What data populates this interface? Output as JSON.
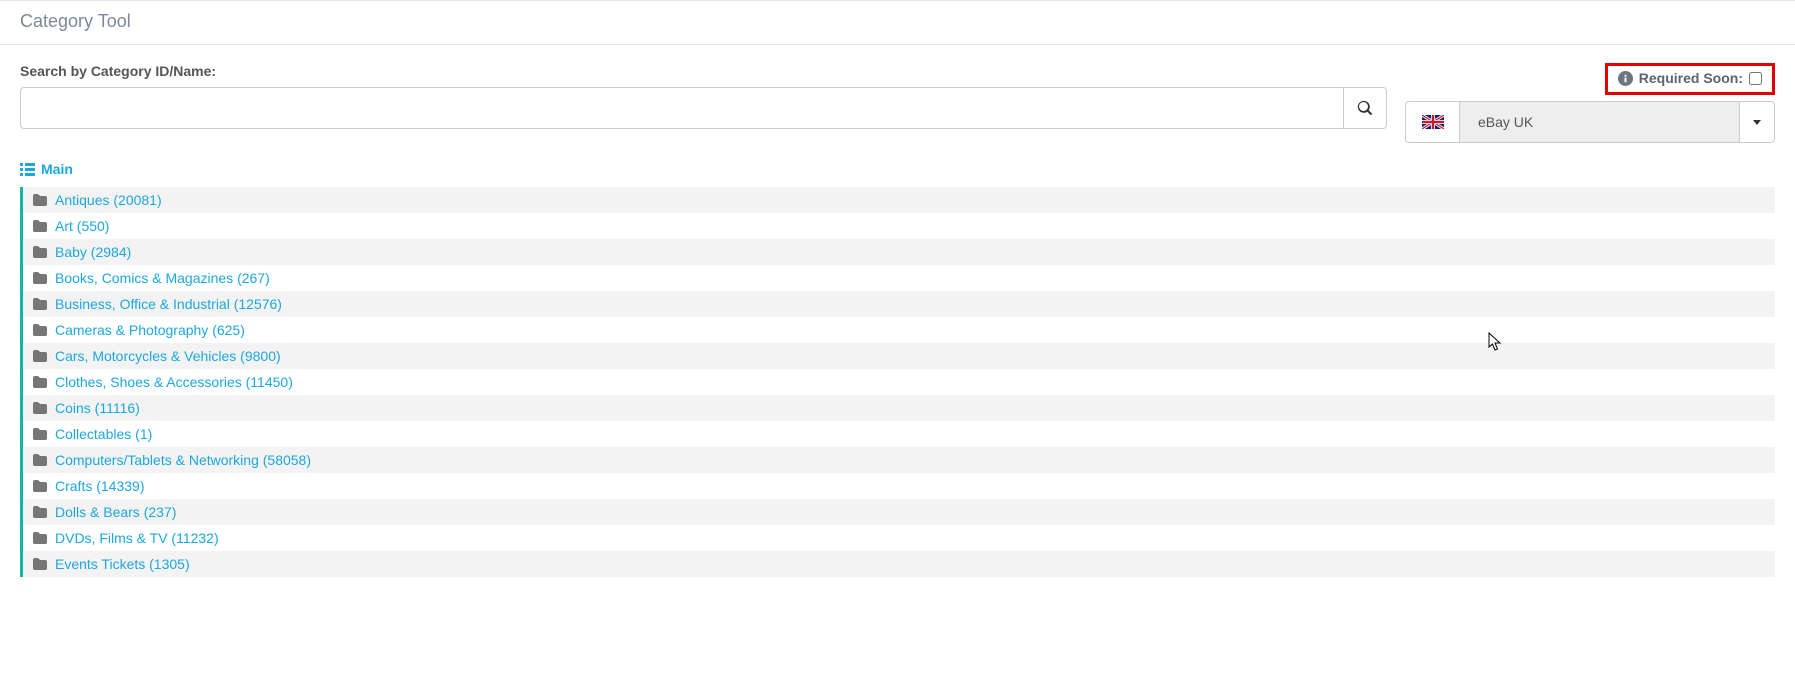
{
  "header": {
    "title": "Category Tool"
  },
  "search": {
    "label": "Search by Category ID/Name:",
    "value": ""
  },
  "required_soon": {
    "label": "Required Soon:"
  },
  "site_select": {
    "label": "eBay UK"
  },
  "breadcrumb": {
    "label": "Main"
  },
  "categories": [
    {
      "label": "Antiques (20081)"
    },
    {
      "label": "Art (550)"
    },
    {
      "label": "Baby (2984)"
    },
    {
      "label": "Books, Comics & Magazines (267)"
    },
    {
      "label": "Business, Office & Industrial (12576)"
    },
    {
      "label": "Cameras & Photography (625)"
    },
    {
      "label": "Cars, Motorcycles & Vehicles (9800)"
    },
    {
      "label": "Clothes, Shoes & Accessories (11450)"
    },
    {
      "label": "Coins (11116)"
    },
    {
      "label": "Collectables (1)"
    },
    {
      "label": "Computers/Tablets & Networking (58058)"
    },
    {
      "label": "Crafts (14339)"
    },
    {
      "label": "Dolls & Bears (237)"
    },
    {
      "label": "DVDs, Films & TV (11232)"
    },
    {
      "label": "Events Tickets (1305)"
    }
  ]
}
